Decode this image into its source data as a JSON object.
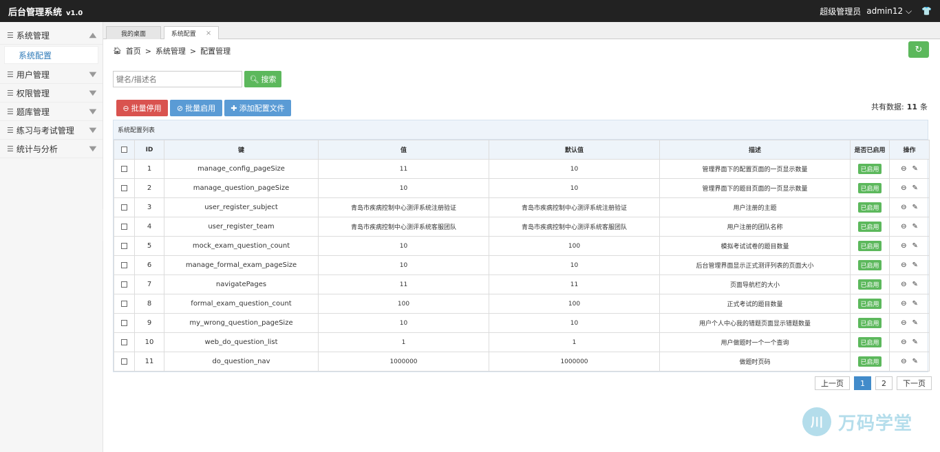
{
  "header": {
    "app_title": "后台管理系统",
    "version": "v1.0",
    "user_role": "超级管理员",
    "username": "admin12"
  },
  "sidebar": {
    "items": [
      {
        "label": "系统管理",
        "expanded": true,
        "chevron": "▲"
      },
      {
        "label": "用户管理",
        "chevron": "▼"
      },
      {
        "label": "权限管理",
        "chevron": "▼"
      },
      {
        "label": "题库管理",
        "chevron": "▼"
      },
      {
        "label": "练习与考试管理",
        "chevron": "▼"
      },
      {
        "label": "统计与分析",
        "chevron": "▼"
      }
    ],
    "sub_items": [
      {
        "label": "系统配置",
        "active": true
      }
    ]
  },
  "tabs": [
    {
      "label": "我的桌面"
    },
    {
      "label": "系统配置",
      "close": "×"
    }
  ],
  "breadcrumb": {
    "home": "首页",
    "sep": ">",
    "level1": "系统管理",
    "level2": "配置管理"
  },
  "search": {
    "placeholder": "键名/描述名",
    "button_label": "搜索"
  },
  "toolbar": {
    "disable_label": "批量停用",
    "enable_label": "批量启用",
    "add_label": "添加配置文件",
    "total_prefix": "共有数据:",
    "total_count": "11",
    "total_suffix": "条"
  },
  "panel_title": "系统配置列表",
  "table": {
    "headers": [
      "ID",
      "键",
      "值",
      "默认值",
      "描述",
      "是否已启用",
      "操作"
    ],
    "rows": [
      {
        "id": "1",
        "key": "manage_config_pageSize",
        "value": "11",
        "default": "10",
        "desc": "管理界面下的配置页面的一页显示数量",
        "status": "已启用"
      },
      {
        "id": "2",
        "key": "manage_question_pageSize",
        "value": "10",
        "default": "10",
        "desc": "管理界面下的题目页面的一页显示数量",
        "status": "已启用"
      },
      {
        "id": "3",
        "key": "user_register_subject",
        "value": "青岛市疾病控制中心测评系统注册验证",
        "default": "青岛市疾病控制中心测评系统注册验证",
        "desc": "用户注册的主题",
        "status": "已启用"
      },
      {
        "id": "4",
        "key": "user_register_team",
        "value": "青岛市疾病控制中心测评系统客服团队",
        "default": "青岛市疾病控制中心测评系统客服团队",
        "desc": "用户注册的团队名称",
        "status": "已启用"
      },
      {
        "id": "5",
        "key": "mock_exam_question_count",
        "value": "10",
        "default": "100",
        "desc": "模拟考试试卷的题目数量",
        "status": "已启用"
      },
      {
        "id": "6",
        "key": "manage_formal_exam_pageSize",
        "value": "10",
        "default": "10",
        "desc": "后台管理界面显示正式测评列表的页面大小",
        "status": "已启用"
      },
      {
        "id": "7",
        "key": "navigatePages",
        "value": "11",
        "default": "11",
        "desc": "页面导航栏的大小",
        "status": "已启用"
      },
      {
        "id": "8",
        "key": "formal_exam_question_count",
        "value": "100",
        "default": "100",
        "desc": "正式考试的题目数量",
        "status": "已启用"
      },
      {
        "id": "9",
        "key": "my_wrong_question_pageSize",
        "value": "10",
        "default": "10",
        "desc": "用户个人中心我的错题页面显示错题数量",
        "status": "已启用"
      },
      {
        "id": "10",
        "key": "web_do_question_list",
        "value": "1",
        "default": "1",
        "desc": "用户做题时一个一个查询",
        "status": "已启用"
      },
      {
        "id": "11",
        "key": "do_question_nav",
        "value": "1000000",
        "default": "1000000",
        "desc": "做题时页码",
        "status": "已启用"
      }
    ]
  },
  "pagination": {
    "prev": "上一页",
    "pages": [
      "1",
      "2"
    ],
    "current": "1",
    "next": "下一页"
  },
  "watermark": {
    "text": "万码学堂"
  },
  "colors": {
    "topbar": "#222222",
    "success": "#5cb85c",
    "danger": "#d9534f",
    "primary": "#5a9bd5",
    "pager_active": "#428bca"
  }
}
